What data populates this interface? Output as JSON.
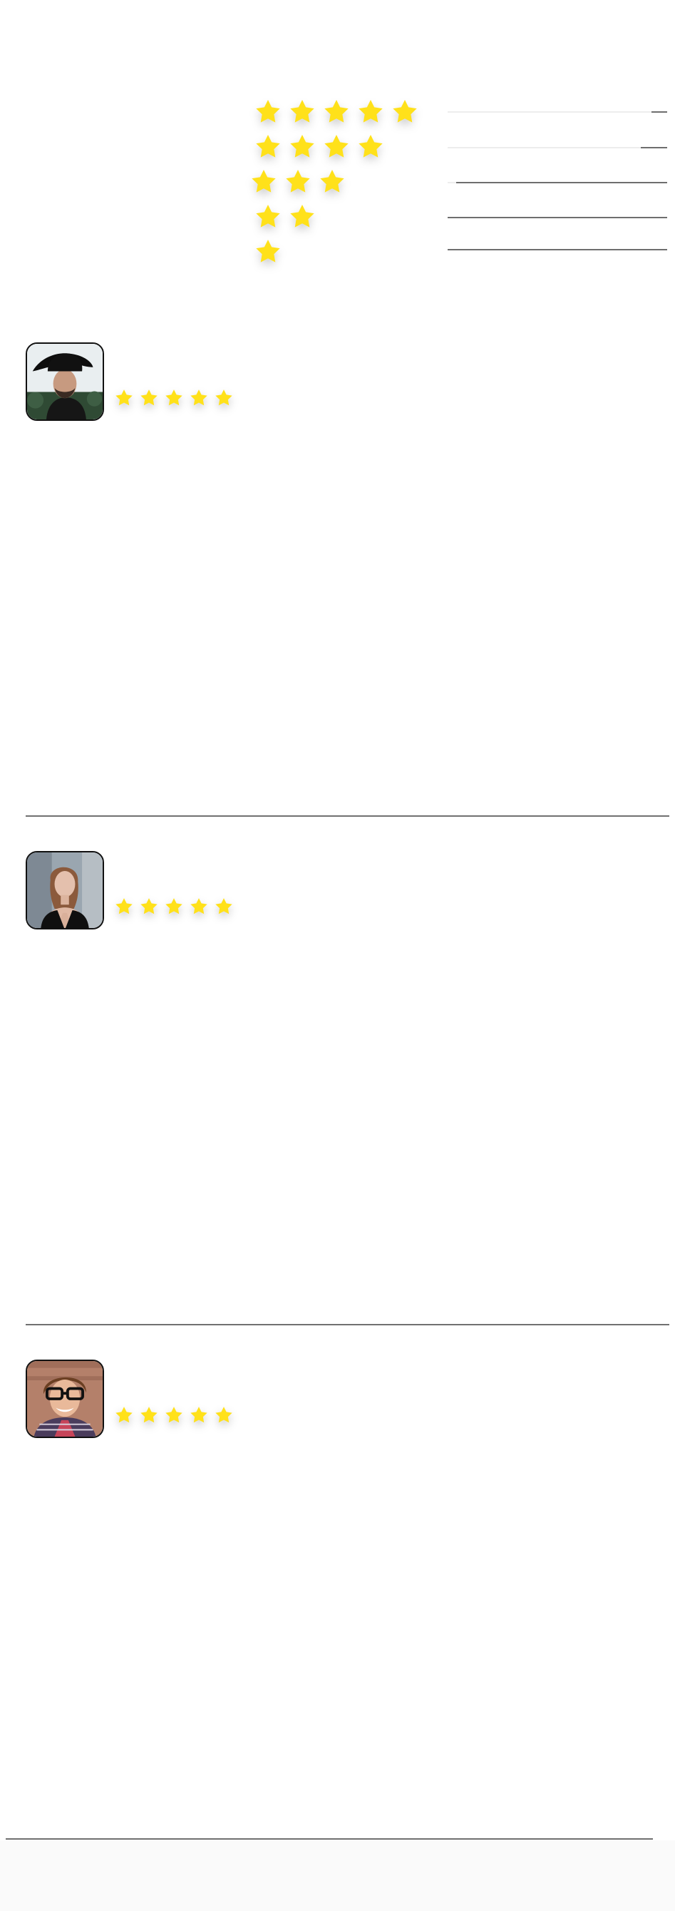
{
  "colors": {
    "star": "#ffe11a",
    "bar_fill": "#6e6e6e",
    "bar_track": "#ededed",
    "divider": "#707070",
    "avatar_border": "#111111"
  },
  "rating_summary": {
    "rows": [
      {
        "stars": 5,
        "share": 0.07
      },
      {
        "stars": 4,
        "share": 0.12
      },
      {
        "stars": 3,
        "share": 0.96
      },
      {
        "stars": 2,
        "share": 1.0
      },
      {
        "stars": 1,
        "share": 1.0
      }
    ]
  },
  "reviews": [
    {
      "avatar": "man-with-black-hat",
      "rating": 5
    },
    {
      "avatar": "woman-with-black-top",
      "rating": 5
    },
    {
      "avatar": "man-with-glasses",
      "rating": 5
    }
  ],
  "icons": {
    "star": "star-icon"
  }
}
